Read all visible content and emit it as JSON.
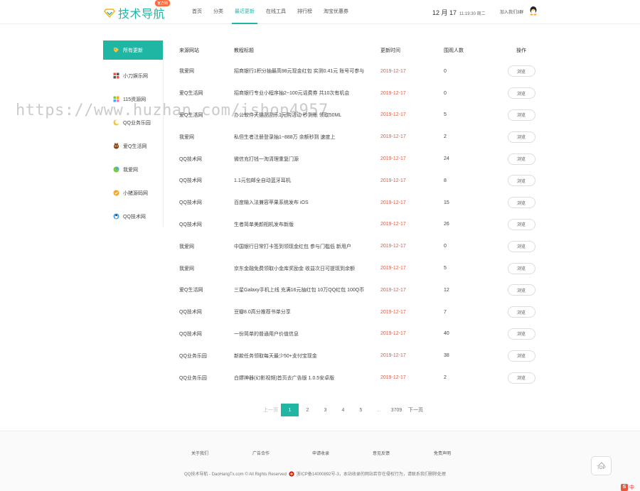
{
  "header": {
    "logo_text": "技术导航",
    "logo_badge": "官方网",
    "nav": [
      "首页",
      "分类",
      "最近更新",
      "在线工具",
      "排行榜",
      "淘宝优惠券"
    ],
    "nav_active_index": 2,
    "date": "12 月 17",
    "time": "11:19:30 周二",
    "join": "加入我们3群"
  },
  "sidebar": {
    "items": [
      {
        "label": "所有更新",
        "icon": "tag-icon",
        "active": true
      },
      {
        "label": "小刀娱乐网",
        "icon": "grid-icon",
        "active": false
      },
      {
        "label": "115资源网",
        "icon": "blocks-icon",
        "active": false
      },
      {
        "label": "QQ业务乐园",
        "icon": "moon-icon",
        "active": false
      },
      {
        "label": "爱Q生活网",
        "icon": "mascot-icon",
        "active": false
      },
      {
        "label": "我爱网",
        "icon": "circle-icon",
        "active": false
      },
      {
        "label": "小猪源码网",
        "icon": "badge-icon",
        "active": false
      },
      {
        "label": "QQ技术网",
        "icon": "penguin-icon",
        "active": false
      }
    ]
  },
  "table": {
    "headers": [
      "来源网站",
      "教程标题",
      "更新时间",
      "围观人数",
      "操作"
    ],
    "view_label": "浏览",
    "rows": [
      {
        "source": "我爱网",
        "title": "招商银行1积分抽最高98元现金红包 实测0.41元 账号可参与",
        "date": "2019-12-17",
        "views": "0"
      },
      {
        "source": "爱Q生活网",
        "title": "招商银行专业小程序抽2~100元话费券 共10次有机会",
        "date": "2019-12-17",
        "views": "0"
      },
      {
        "source": "爱Q生活网",
        "title": "办公软件天猫刮刮乐1元购活动 秒到账 领取50ML",
        "date": "2019-12-17",
        "views": "5"
      },
      {
        "source": "我爱网",
        "title": "私但生者注册登录抽1~888万 余额秒到 速度上",
        "date": "2019-12-17",
        "views": "2"
      },
      {
        "source": "QQ技术网",
        "title": "微信充打钱一淘清理重复门源",
        "date": "2019-12-17",
        "views": "24"
      },
      {
        "source": "QQ技术网",
        "title": "1.1元包邮全自动蓝牙耳机",
        "date": "2019-12-17",
        "views": "8"
      },
      {
        "source": "QQ技术网",
        "title": "百度输入法兼容苹果系统发布 iOS",
        "date": "2019-12-17",
        "views": "15"
      },
      {
        "source": "QQ技术网",
        "title": "生者简单美颜相机发布新版",
        "date": "2019-12-17",
        "views": "26"
      },
      {
        "source": "我爱网",
        "title": "中国银行日常打卡签到领现金红包 参与门槛低 新用户",
        "date": "2019-12-17",
        "views": "0"
      },
      {
        "source": "我爱网",
        "title": "京东金融免费领取小金库奖励金 收益次日可提现到余额",
        "date": "2019-12-17",
        "views": "5"
      },
      {
        "source": "爱Q生活网",
        "title": "三星Galaxy手机上线 充满16元抽红包 10万QQ红包 100Q币",
        "date": "2019-12-17",
        "views": "12"
      },
      {
        "source": "QQ技术网",
        "title": "豆瓣8.0高分推荐书单分享",
        "date": "2019-12-17",
        "views": "7"
      },
      {
        "source": "QQ技术网",
        "title": "一份简单的普通用户价值信息",
        "date": "2019-12-17",
        "views": "40"
      },
      {
        "source": "QQ业务乐园",
        "title": "新款任务领取每天最少50+支付宝现金",
        "date": "2019-12-17",
        "views": "38"
      },
      {
        "source": "QQ业务乐园",
        "title": "白嫖神器(幻影视频)首页去广告版 1.0.5安卓版",
        "date": "2019-12-17",
        "views": "2"
      }
    ]
  },
  "pager": {
    "prev": "上一页",
    "pages": [
      "1",
      "2",
      "3",
      "4",
      "5"
    ],
    "ellipsis": "...",
    "total": "3709",
    "next": "下一页",
    "current": "1"
  },
  "footer": {
    "links": [
      "关于我们",
      "广告合作",
      "申请收录",
      "意见反馈",
      "免责声明"
    ],
    "copyright_left": "QQ技术导航 - DaoHangTx.com © All Rights Reserved",
    "icp": "浙ICP备14000892号-3，本站收录的网站若存在侵权行为，请联系我们删除处理",
    "top_label": "TOP",
    "ime_label": "中"
  },
  "watermark": "https://www.huzhan.com/ishop4957",
  "colors": {
    "accent": "#1fb6a3",
    "date_red": "#e8563e"
  }
}
